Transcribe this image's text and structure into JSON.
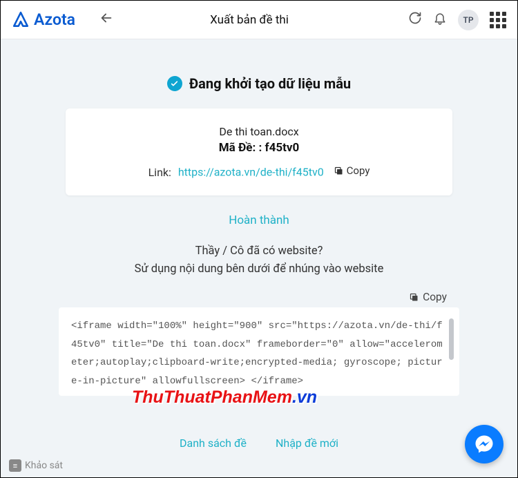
{
  "brand": "Azota",
  "header": {
    "title": "Xuất bản đề thi",
    "avatar_initials": "TP"
  },
  "status": {
    "text": "Đang khởi tạo dữ liệu mẫu"
  },
  "card": {
    "file_name": "De thi toan.docx",
    "code_label": "Mã Đề: :",
    "code_value": "f45tv0",
    "link_label": "Link:",
    "link_url": "https://azota.vn/de-thi/f45tv0",
    "copy_label": "Copy"
  },
  "done_label": "Hoàn thành",
  "embed_prompt_line1": "Thầy / Cô đã có website?",
  "embed_prompt_line2": "Sử dụng nội dung bên dưới để nhúng vào website",
  "embed": {
    "copy_label": "Copy",
    "code": "<iframe width=\"100%\" height=\"900\" src=\"https://azota.vn/de-thi/f45tv0\"  title=\"De thi toan.docx\" frameborder=\"0\" allow=\"accelerometer;autoplay;clipboard-write;encrypted-media; gyroscope; picture-in-picture\" allowfullscreen> </iframe>"
  },
  "footer": {
    "list_label": "Danh sách đề",
    "new_label": "Nhập đề mới"
  },
  "survey_label": "Khảo sát",
  "watermark": {
    "main": "ThuThuatPhanMem",
    "suffix": ".vn"
  }
}
